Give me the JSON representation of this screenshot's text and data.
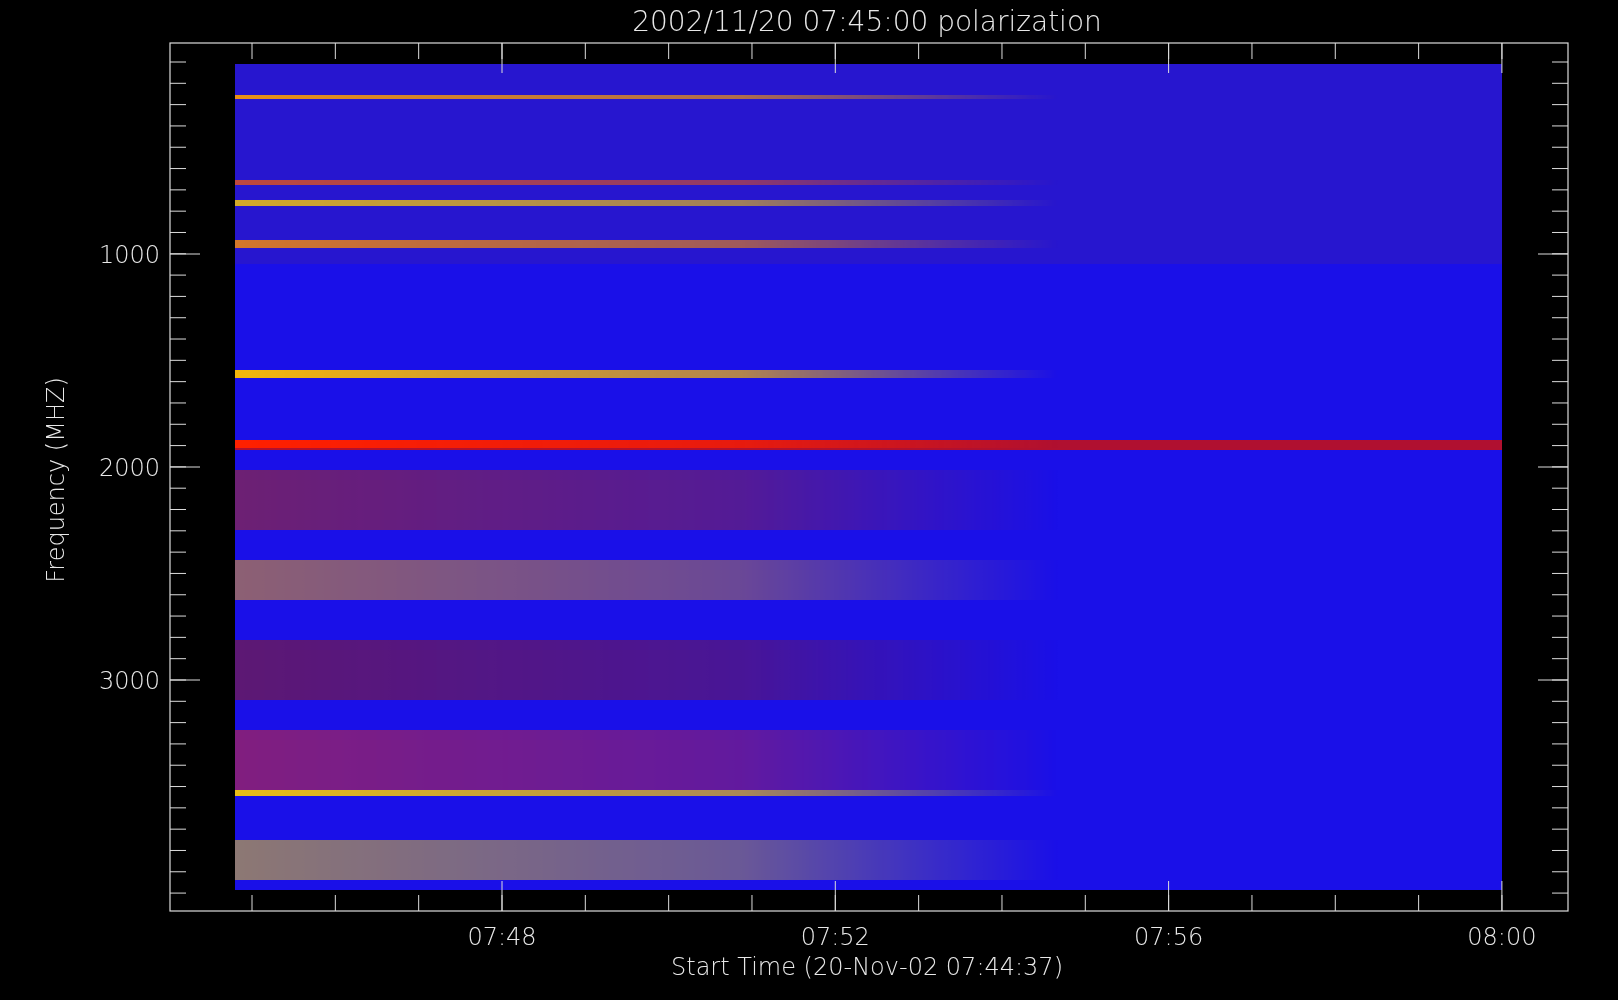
{
  "plot": {
    "title": "2002/11/20 07:45:00 polarization",
    "xlabel": "Start Time (20-Nov-02 07:44:37)",
    "ylabel": "Frequency (MHZ)",
    "xticks": [
      "07:48",
      "07:52",
      "07:56",
      "08:00"
    ],
    "yticks": [
      "1000",
      "2000",
      "3000"
    ]
  }
}
